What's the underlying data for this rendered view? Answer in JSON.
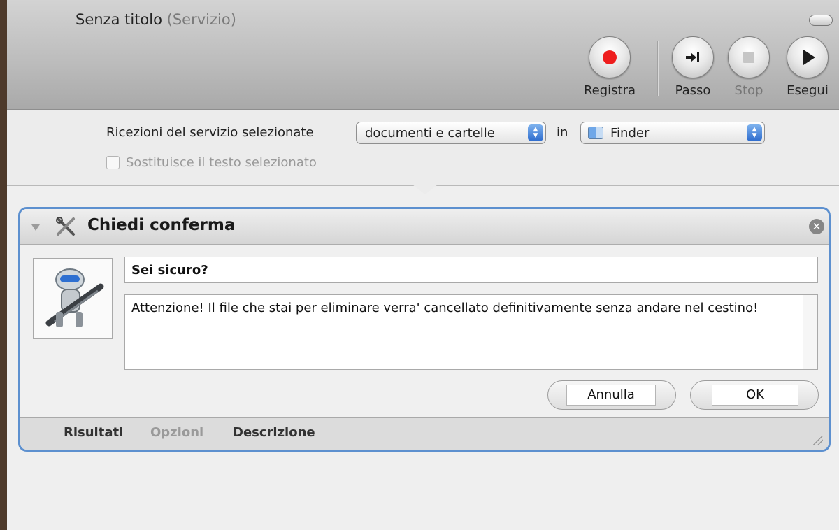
{
  "window": {
    "title": "Senza titolo",
    "subtitle": "(Servizio)"
  },
  "toolbar": {
    "record_label": "Registra",
    "step_label": "Passo",
    "stop_label": "Stop",
    "run_label": "Esegui"
  },
  "service": {
    "receives_label": "Ricezioni del servizio selezionate",
    "input_type": "documenti e cartelle",
    "in_label": "in",
    "application": "Finder",
    "replace_checkbox_label": "Sostituisce il testo selezionato",
    "replace_checked": false
  },
  "action": {
    "title": "Chiedi conferma",
    "question": "Sei sicuro?",
    "message": "Attenzione! Il file che stai per eliminare verra' cancellato definitivamente senza andare nel cestino!",
    "cancel_label": "Annulla",
    "ok_label": "OK",
    "footer_tabs": [
      "Risultati",
      "Opzioni",
      "Descrizione"
    ]
  },
  "icons": {
    "record": "record-icon",
    "step": "step-icon",
    "stop": "stop-icon",
    "run": "play-icon",
    "action": "tools-icon",
    "close": "close-icon",
    "finder": "finder-icon",
    "automator": "automator-robot-icon"
  },
  "colors": {
    "accent_blue": "#5d90cf",
    "record_red": "#ee1d1d"
  }
}
